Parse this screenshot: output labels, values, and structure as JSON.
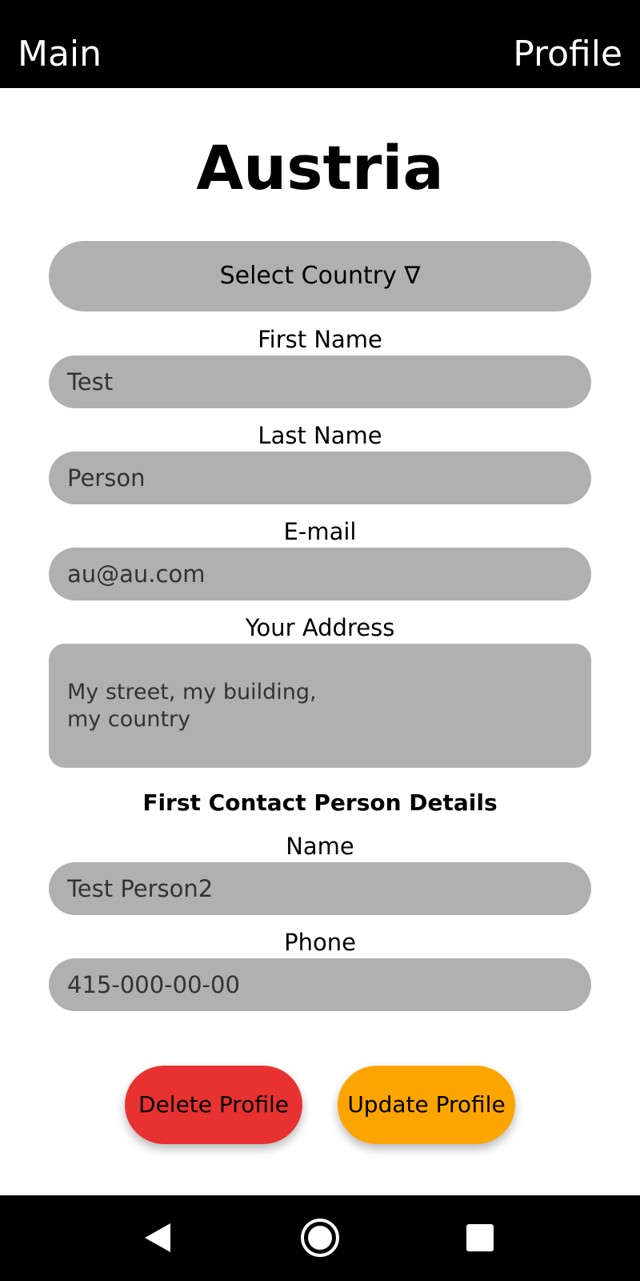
{
  "topbar": {
    "main_label": "Main",
    "profile_label": "Profile"
  },
  "page": {
    "title": "Austria"
  },
  "country_select": {
    "label": "Select Country ∇"
  },
  "form": {
    "first_name": {
      "label": "First Name",
      "value": "Test"
    },
    "last_name": {
      "label": "Last Name",
      "value": "Person"
    },
    "email": {
      "label": "E-mail",
      "value": "au@au.com"
    },
    "address": {
      "label": "Your Address",
      "value": "My street, my building,\nmy country"
    }
  },
  "contact": {
    "heading": "First Contact Person Details",
    "name": {
      "label": "Name",
      "value": "Test Person2"
    },
    "phone": {
      "label": "Phone",
      "value": "415-000-00-00"
    }
  },
  "actions": {
    "delete_label": "Delete Profile",
    "update_label": "Update Profile",
    "delete_color": "#e83232",
    "update_color": "#fca500"
  },
  "system_nav": {
    "back_icon": "back-triangle-icon",
    "home_icon": "home-circle-icon",
    "recents_icon": "recents-square-icon"
  },
  "colors": {
    "bar_background": "#000000",
    "field_background": "#b0b0b0",
    "page_background": "#ffffff"
  }
}
